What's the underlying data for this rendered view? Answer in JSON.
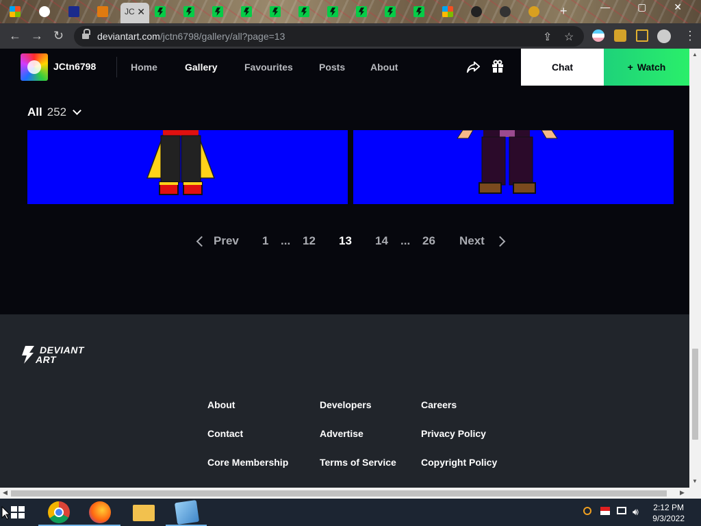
{
  "browser": {
    "url_domain": "deviantart.com",
    "url_path": "/jctn6798/gallery/all?page=13",
    "active_tab_label": "JC",
    "window_controls": "— ▢ ✕"
  },
  "site": {
    "username": "JCtn6798",
    "nav": [
      "Home",
      "Gallery",
      "Favourites",
      "Posts",
      "About"
    ],
    "active_nav": "Gallery",
    "chat_label": "Chat",
    "watch_label": "Watch",
    "watch_plus": "+"
  },
  "gallery": {
    "filter_label": "All",
    "filter_count": "252",
    "thumb_color": "#0000ff"
  },
  "pagination": {
    "prev_label": "Prev",
    "next_label": "Next",
    "first": "1",
    "ellipsis": "...",
    "before": "12",
    "current": "13",
    "after": "14",
    "last": "26"
  },
  "footer": {
    "logo_line1": "DEVIANT",
    "logo_line2": "ART",
    "links": [
      [
        "About",
        "Developers",
        "Careers"
      ],
      [
        "Contact",
        "Advertise",
        "Privacy Policy"
      ],
      [
        "Core Membership",
        "Terms of Service",
        "Copyright Policy"
      ]
    ]
  },
  "taskbar": {
    "time": "2:12 PM",
    "date": "9/3/2022"
  },
  "colors": {
    "accent_green": "#1ed27a",
    "page_bg": "#06070d",
    "footer_bg": "#21252b"
  }
}
